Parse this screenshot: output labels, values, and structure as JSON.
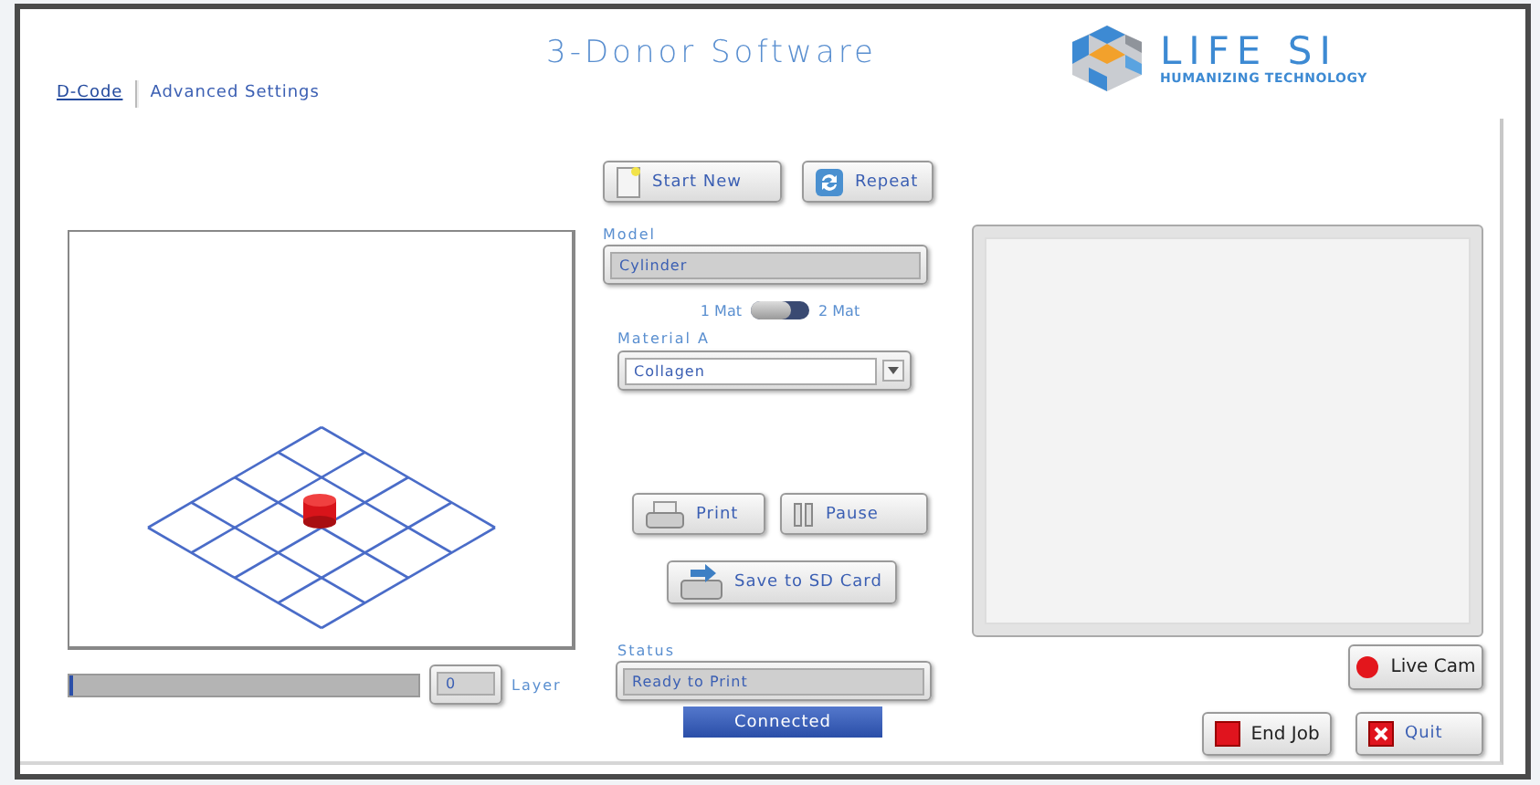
{
  "window": {
    "title": "3-Donor Software"
  },
  "logo": {
    "name": "LIFE SI",
    "tagline": "HUMANIZING TECHNOLOGY"
  },
  "tabs": [
    {
      "label": "D-Code",
      "selected": true
    },
    {
      "label": "Advanced Settings",
      "selected": false
    }
  ],
  "top_buttons": [
    {
      "label": "Start New",
      "kind": "new"
    },
    {
      "label": "Repeat",
      "kind": "repeat"
    }
  ],
  "model": {
    "label": "Model",
    "value": "Cylinder"
  },
  "material_switch": {
    "left_label": "1 Mat",
    "right_label": "2 Mat",
    "on": false
  },
  "material_a": {
    "label": "Material A",
    "value": "Collagen"
  },
  "print_buttons": [
    {
      "label": "Print",
      "kind": "print"
    },
    {
      "label": "Pause",
      "kind": "pause"
    }
  ],
  "save_button": {
    "label": "Save to SD Card"
  },
  "status": {
    "label": "Status",
    "value": "Ready to Print"
  },
  "connection": {
    "label": "Connected"
  },
  "layer": {
    "level": 0.01,
    "value": "0",
    "label": "Layer"
  },
  "live_cam": {
    "label": "Live Cam"
  },
  "bottom_buttons": [
    {
      "label": "End Job",
      "kind": "end"
    },
    {
      "label": "Quit",
      "kind": "quit"
    }
  ]
}
